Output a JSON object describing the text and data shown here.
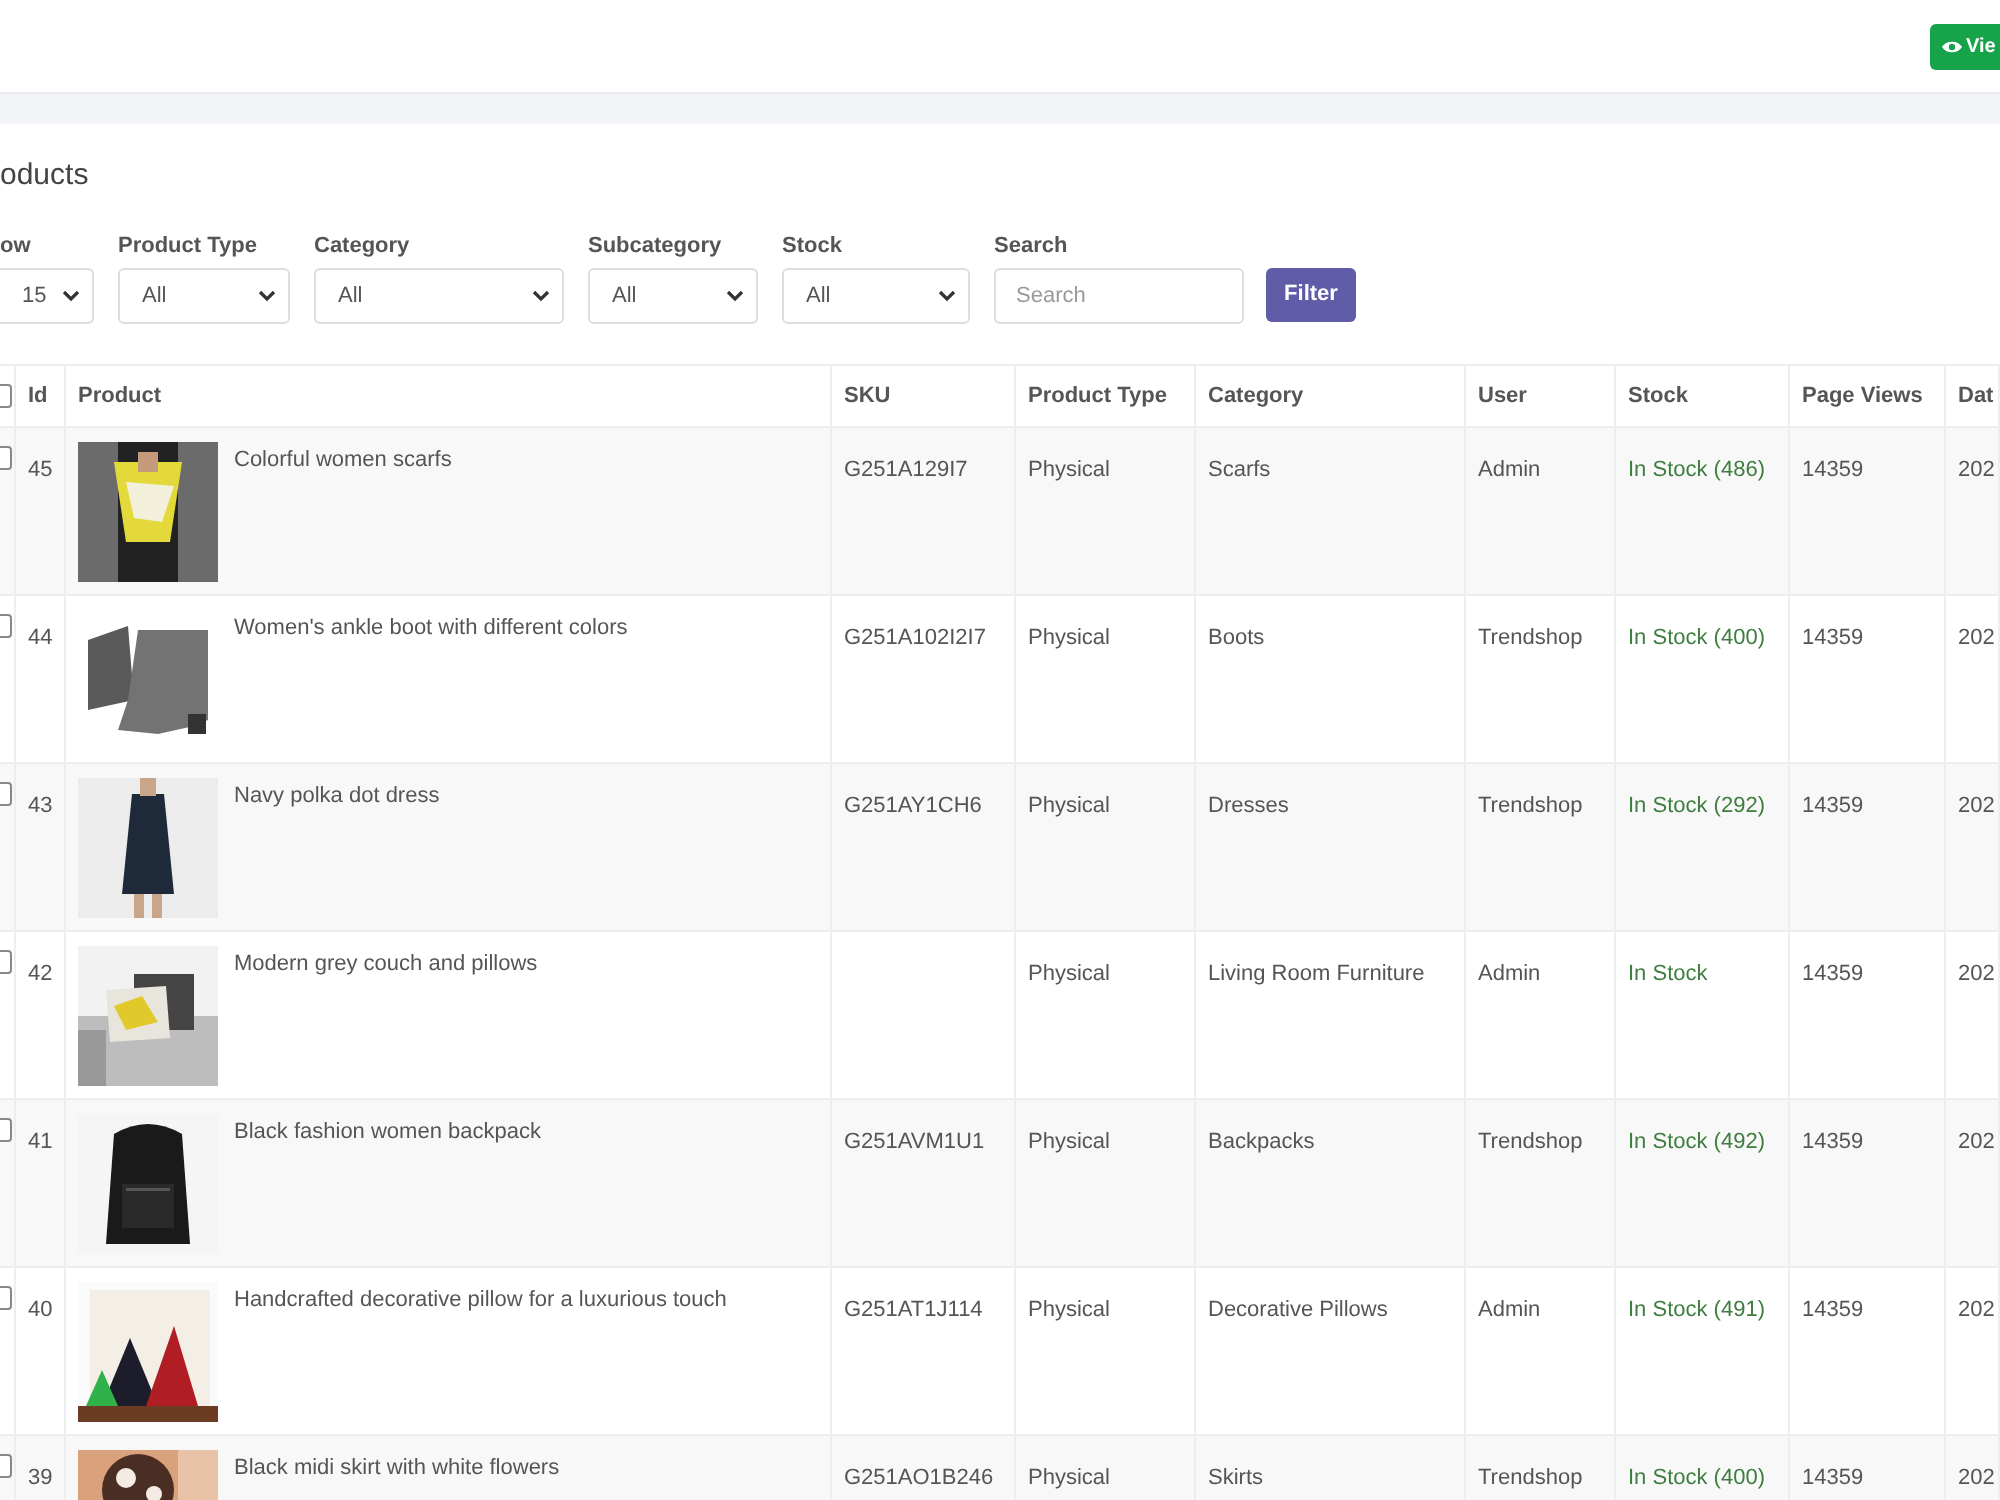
{
  "header": {
    "view_button": "Vie"
  },
  "title": "oducts",
  "filters": [
    {
      "kind": "select",
      "label": "ow",
      "value": "15"
    },
    {
      "kind": "select",
      "label": "Product Type",
      "value": "All"
    },
    {
      "kind": "select",
      "label": "Category",
      "value": "All"
    },
    {
      "kind": "select",
      "label": "Subcategory",
      "value": "All"
    },
    {
      "kind": "select",
      "label": "Stock",
      "value": "All"
    },
    {
      "kind": "search",
      "label": "Search",
      "placeholder": "Search"
    }
  ],
  "filter_button": "Filter",
  "table": {
    "select_all_checked": false,
    "columns": [
      "Id",
      "Product",
      "SKU",
      "Product Type",
      "Category",
      "User",
      "Stock",
      "Page Views",
      "Dat"
    ],
    "rows": [
      {
        "checked": false,
        "id": "45",
        "product": "Colorful women scarfs",
        "sku": "G251A129I7",
        "type": "Physical",
        "category": "Scarfs",
        "user": "Admin",
        "stock": "In Stock (486)",
        "views": "14359",
        "date": "202"
      },
      {
        "checked": false,
        "id": "44",
        "product": "Women's ankle boot with different colors",
        "sku": "G251A102I2I7",
        "type": "Physical",
        "category": "Boots",
        "user": "Trendshop",
        "stock": "In Stock (400)",
        "views": "14359",
        "date": "202"
      },
      {
        "checked": false,
        "id": "43",
        "product": "Navy polka dot dress",
        "sku": "G251AY1CH6",
        "type": "Physical",
        "category": "Dresses",
        "user": "Trendshop",
        "stock": "In Stock (292)",
        "views": "14359",
        "date": "202"
      },
      {
        "checked": false,
        "id": "42",
        "product": "Modern grey couch and pillows",
        "type": "Physical",
        "category": "Living Room Furniture",
        "user": "Admin",
        "stock": "In Stock",
        "views": "14359",
        "date": "202"
      },
      {
        "checked": false,
        "id": "41",
        "product": "Black fashion women backpack",
        "sku": "G251AVM1U1",
        "type": "Physical",
        "category": "Backpacks",
        "user": "Trendshop",
        "stock": "In Stock (492)",
        "views": "14359",
        "date": "202"
      },
      {
        "checked": false,
        "id": "40",
        "product": "Handcrafted decorative pillow for a luxurious touch",
        "sku": "G251AT1J114",
        "type": "Physical",
        "category": "Decorative Pillows",
        "user": "Admin",
        "stock": "In Stock (491)",
        "views": "14359",
        "date": "202"
      },
      {
        "checked": false,
        "id": "39",
        "product": "Black midi skirt with white flowers",
        "sku": "G251AO1B246",
        "type": "Physical",
        "category": "Skirts",
        "user": "Trendshop",
        "stock": "In Stock (400)",
        "views": "14359",
        "date": "202"
      }
    ]
  }
}
